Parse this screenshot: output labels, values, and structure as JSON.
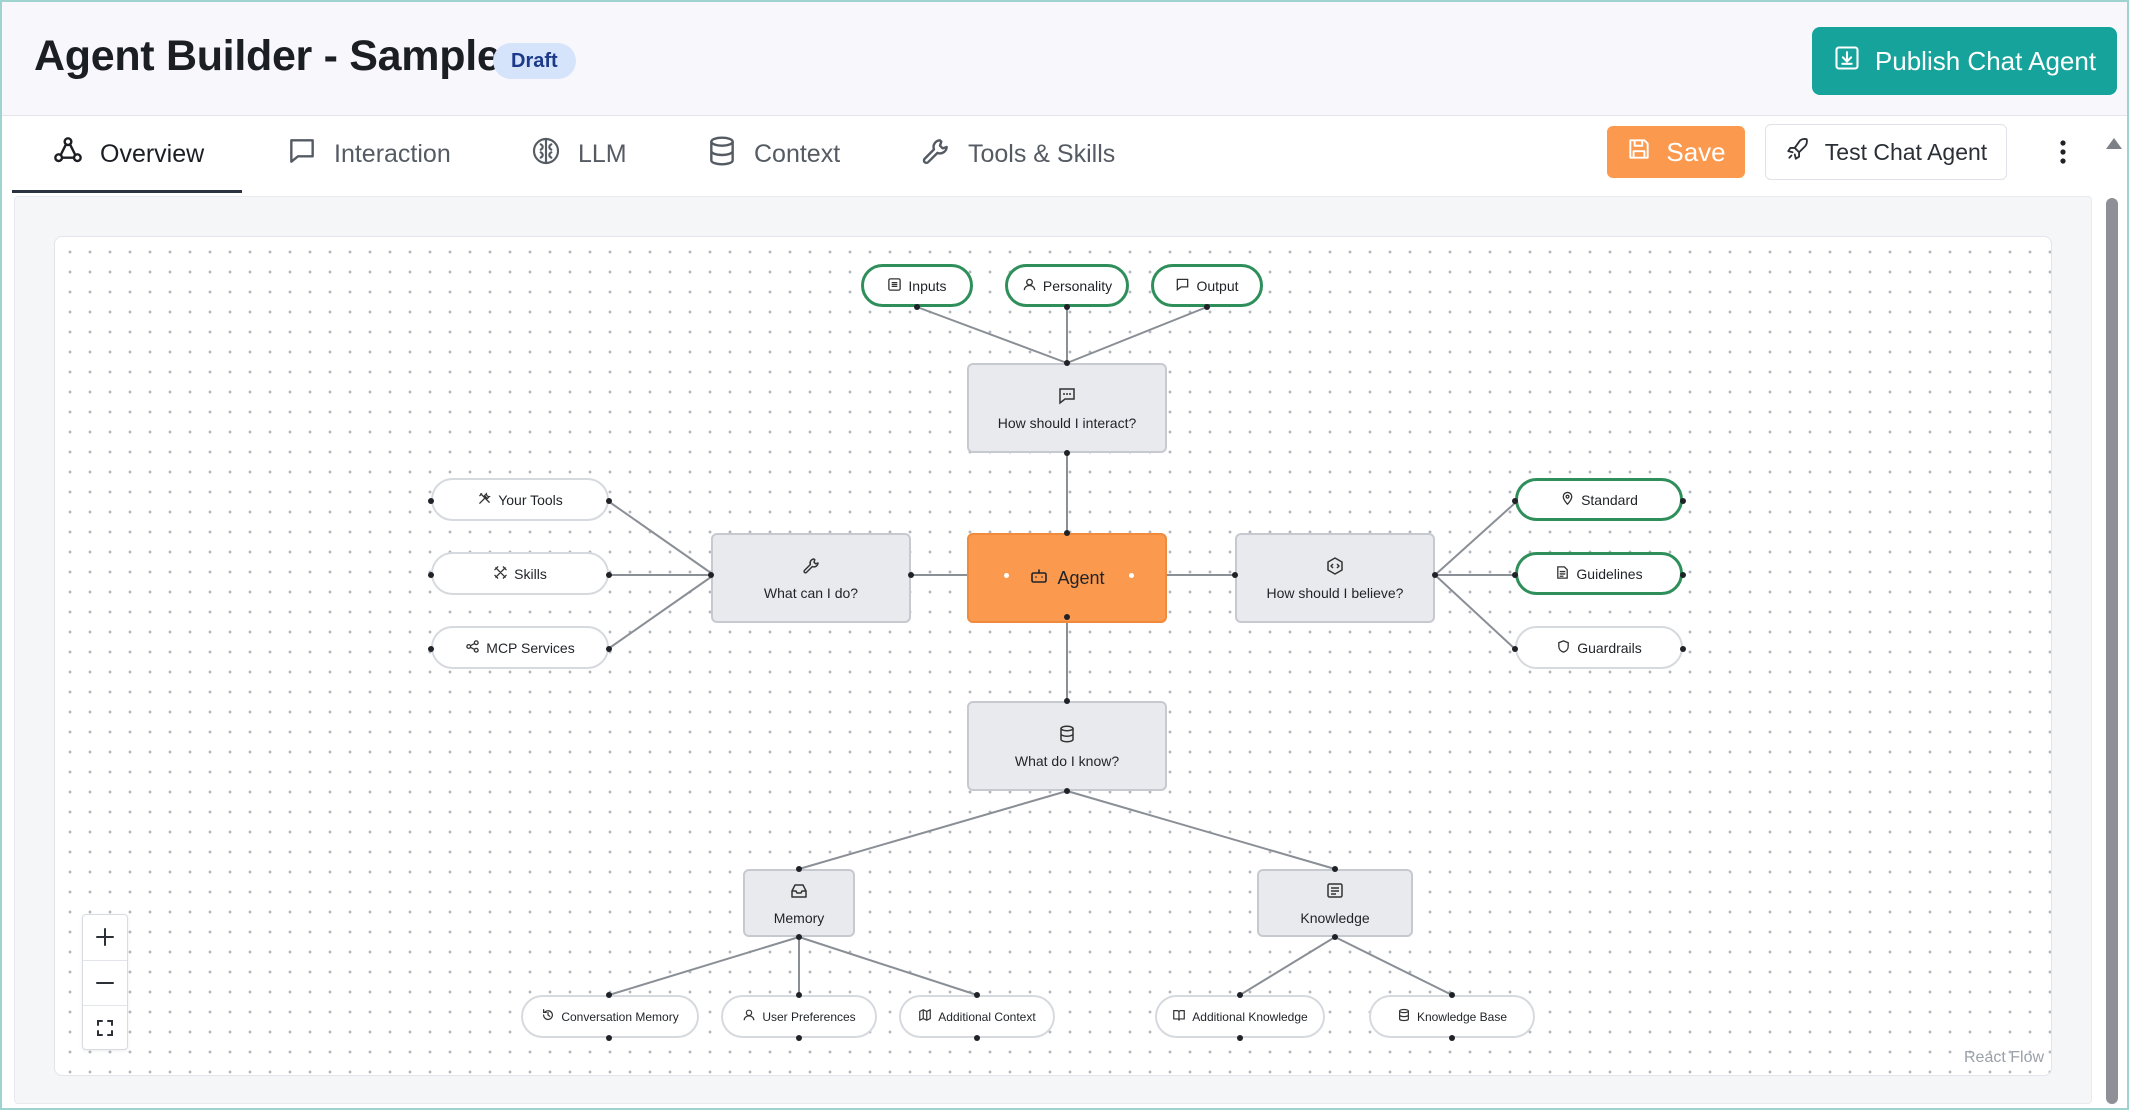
{
  "header": {
    "title": "Agent Builder - Sample",
    "status_badge": "Draft",
    "publish_label": "Publish Chat Agent",
    "publish_icon": "download-icon"
  },
  "tabs": [
    {
      "label": "Overview",
      "icon": "workflow-icon",
      "active": true
    },
    {
      "label": "Interaction",
      "icon": "message-square-icon",
      "active": false
    },
    {
      "label": "LLM",
      "icon": "brain-icon",
      "active": false
    },
    {
      "label": "Context",
      "icon": "database-icon",
      "active": false
    },
    {
      "label": "Tools & Skills",
      "icon": "wrench-icon",
      "active": false
    }
  ],
  "toolbar": {
    "save_label": "Save",
    "test_label": "Test Chat Agent",
    "more_icon": "more-vertical-icon"
  },
  "canvas": {
    "nodes": {
      "inputs": "Inputs",
      "personality": "Personality",
      "output": "Output",
      "interact": "How should I interact?",
      "your_tools": "Your Tools",
      "skills": "Skills",
      "mcp_services": "MCP Services",
      "what_can_i_do": "What can I do?",
      "agent": "Agent",
      "believe": "How should I believe?",
      "standard": "Standard",
      "guidelines": "Guidelines",
      "guardrails": "Guardrails",
      "what_do_i_know": "What do I know?",
      "memory": "Memory",
      "knowledge": "Knowledge",
      "conversation_memory": "Conversation Memory",
      "user_preferences": "User Preferences",
      "additional_context": "Additional Context",
      "additional_knowledge": "Additional Knowledge",
      "knowledge_base": "Knowledge Base"
    },
    "attribution": "React Flow"
  },
  "colors": {
    "accent_teal": "#15a39c",
    "save_orange": "#fb9a4e",
    "agent_orange": "#fb9a4e",
    "badge_blue": "#d6e4fb",
    "selected_green": "#2f8f5b"
  }
}
